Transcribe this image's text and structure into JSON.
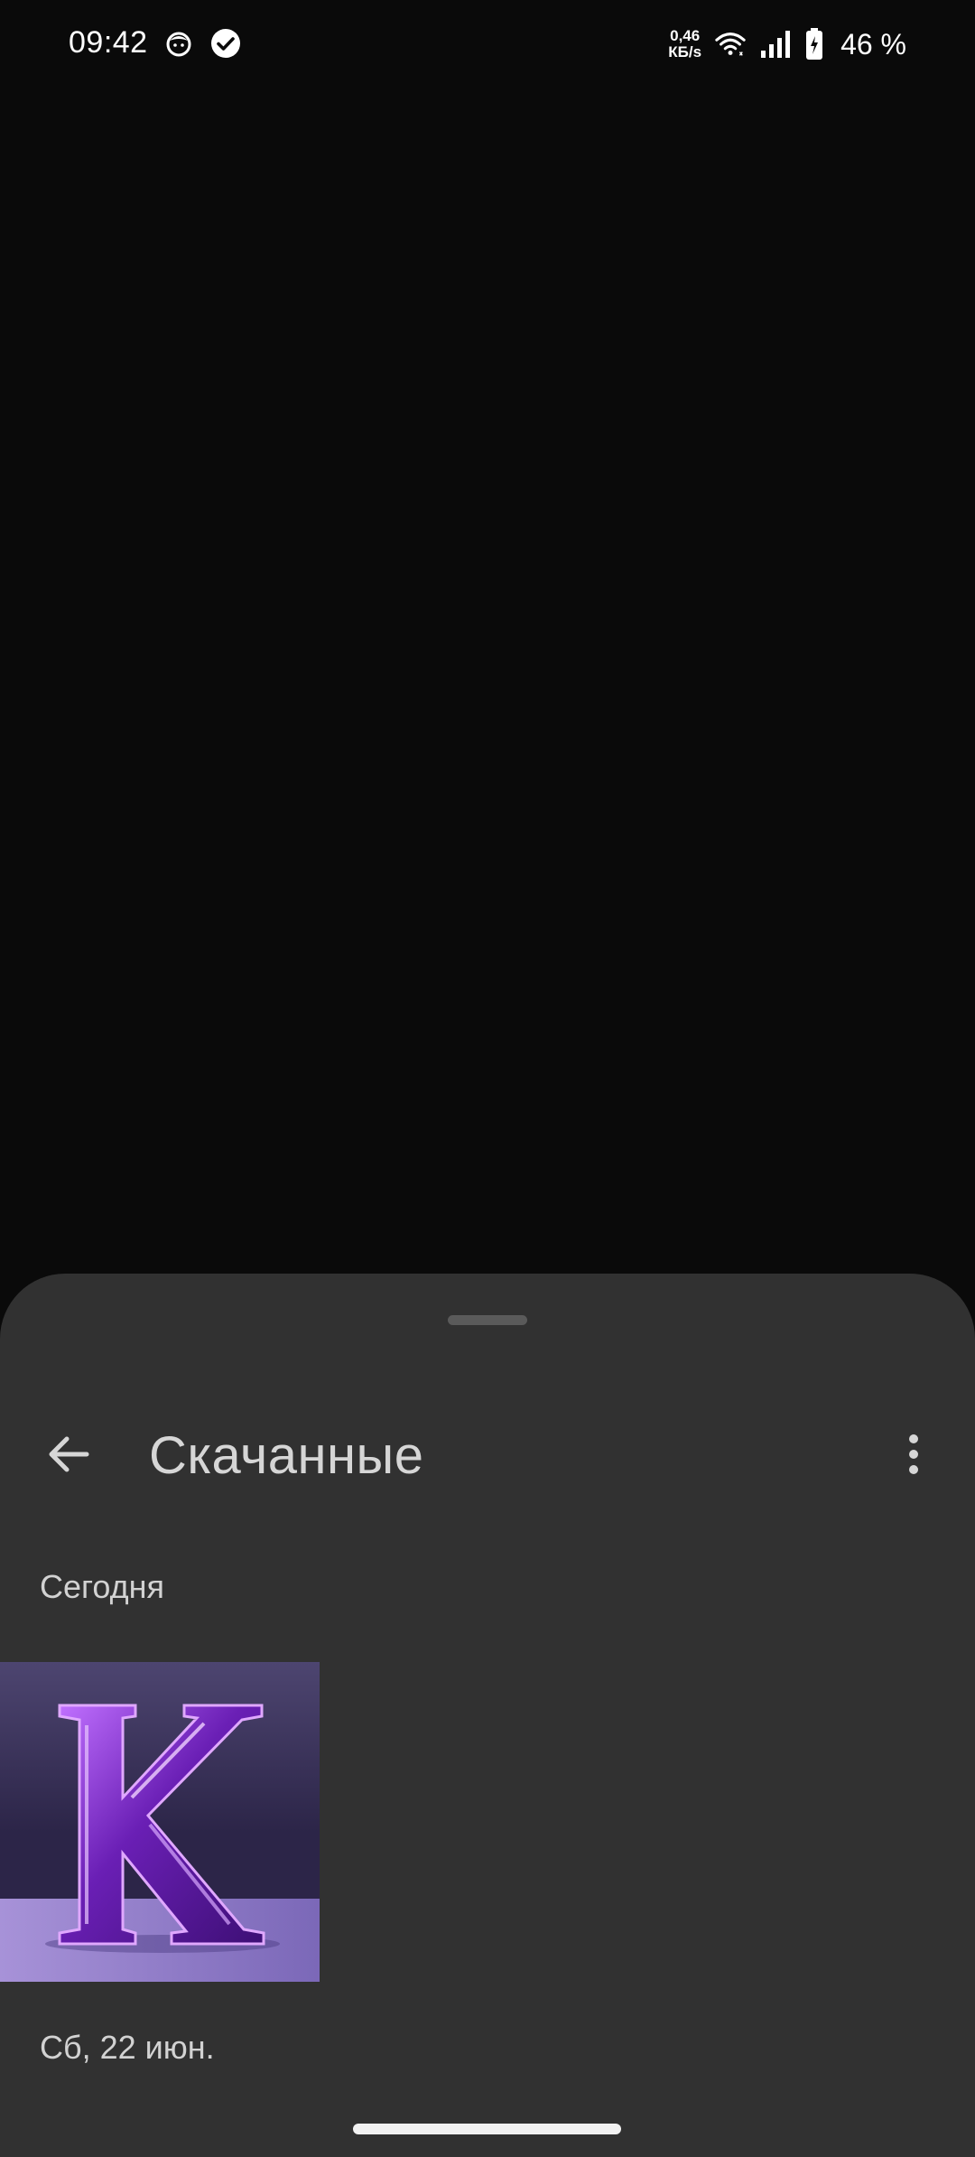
{
  "status_bar": {
    "time": "09:42",
    "net_speed_value": "0,46",
    "net_speed_unit": "КБ/s",
    "battery": "46 %",
    "icons": [
      "face-notification-icon",
      "check-circle-icon",
      "wifi-icon",
      "signal-icon",
      "battery-charging-icon"
    ]
  },
  "sheet": {
    "title": "Скачанные",
    "back_icon": "arrow-back-icon",
    "more_icon": "more-vert-icon",
    "sections": [
      {
        "header": "Сегодня",
        "items": [
          {
            "thumbnail": "purple-letter-k-image",
            "colors": {
              "bg_top": "#4a4069",
              "bg_bottom": "#2c2548",
              "floor": "#8a78c2",
              "letter": "#7a2fc9"
            }
          }
        ]
      },
      {
        "header": "Сб, 22 июн.",
        "items": []
      }
    ]
  },
  "colors": {
    "background": "#0a0a0a",
    "sheet": "#313131",
    "title_text": "#d6d6d6"
  }
}
